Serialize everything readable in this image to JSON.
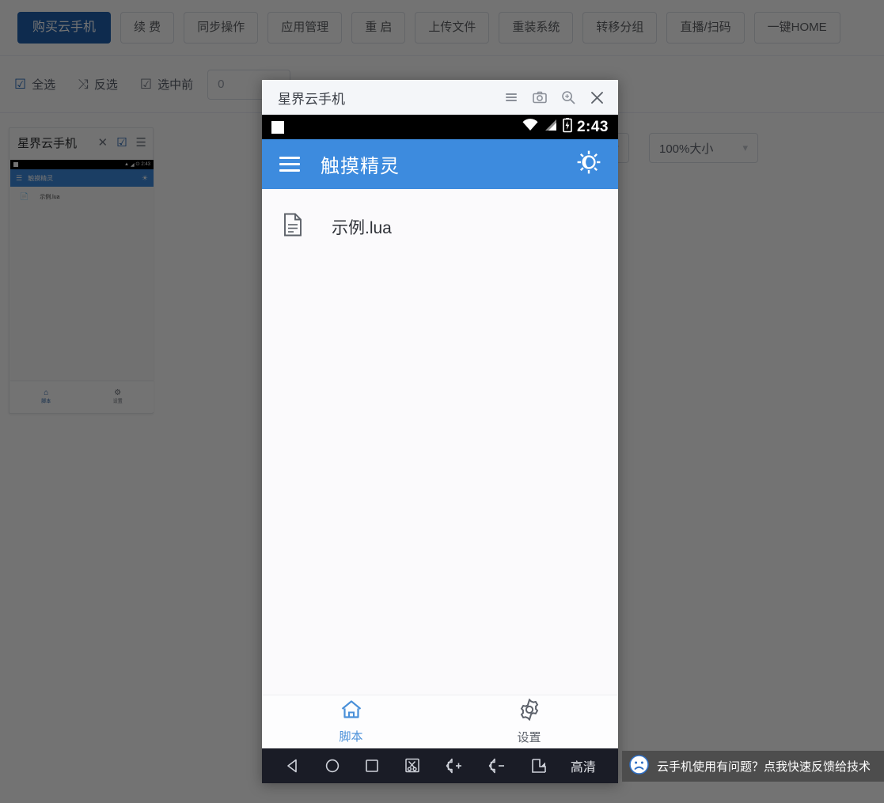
{
  "toolbar": {
    "buttons": [
      {
        "label": "购买云手机",
        "primary": true
      },
      {
        "label": "续 费",
        "primary": false
      },
      {
        "label": "同步操作",
        "primary": false
      },
      {
        "label": "应用管理",
        "primary": false
      },
      {
        "label": "重 启",
        "primary": false
      },
      {
        "label": "上传文件",
        "primary": false
      },
      {
        "label": "重装系统",
        "primary": false
      },
      {
        "label": "转移分组",
        "primary": false
      },
      {
        "label": "直播/扫码",
        "primary": false
      },
      {
        "label": "一键HOME",
        "primary": false
      }
    ]
  },
  "controls": {
    "select_all": {
      "label": "全选",
      "icon": "checkbox-checked-icon"
    },
    "invert": {
      "label": "反选",
      "icon": "shuffle-icon"
    },
    "select_first_n": {
      "label": "选中前",
      "icon": "checkbox-checked-icon"
    },
    "count_input": {
      "value": "0",
      "placeholder": "0"
    },
    "size_select": {
      "value": "100%大小",
      "chevron": "chevron-down-icon"
    }
  },
  "device_card": {
    "title": "星界云手机",
    "icons": [
      "close-icon",
      "checkbox-checked-icon",
      "menu-icon"
    ],
    "status_bar": {
      "time": "2:43"
    },
    "app_bar": {
      "title": "触摸精灵"
    },
    "file": {
      "name": "示例.lua"
    },
    "tabs": [
      {
        "label": "脚本",
        "icon": "home-icon",
        "active": true
      },
      {
        "label": "设置",
        "icon": "gear-icon",
        "active": false
      }
    ]
  },
  "modal": {
    "title": "星界云手机",
    "header_icons": [
      "menu-icon",
      "camera-icon",
      "zoom-in-icon",
      "close-icon"
    ],
    "status_bar": {
      "time": "2:43",
      "icons": [
        "wifi-icon",
        "signal-icon",
        "battery-charging-icon"
      ]
    },
    "app_bar": {
      "title": "触摸精灵",
      "menu_icon": "hamburger-icon",
      "action_icon": "brightness-icon"
    },
    "files": [
      {
        "name": "示例.lua",
        "icon": "file-icon"
      }
    ],
    "tabs": [
      {
        "label": "脚本",
        "icon": "home-icon",
        "active": true
      },
      {
        "label": "设置",
        "icon": "gear-icon",
        "active": false
      }
    ],
    "nav_bar": {
      "buttons": [
        "back-icon",
        "home-icon",
        "recents-icon",
        "scissors-icon",
        "volume-up-icon",
        "volume-down-icon",
        "screenshot-icon"
      ],
      "quality_label": "高清"
    }
  },
  "feedback": {
    "text": "云手机使用有问题？点我快速反馈给技术",
    "icon": "sad-face-icon"
  },
  "colors": {
    "primary": "#1f5fae",
    "app_blue": "#3d8bde",
    "tab_active": "#4a90d9",
    "nav_dark": "#1a1c26",
    "feedback_bg": "#4d4d4d"
  }
}
